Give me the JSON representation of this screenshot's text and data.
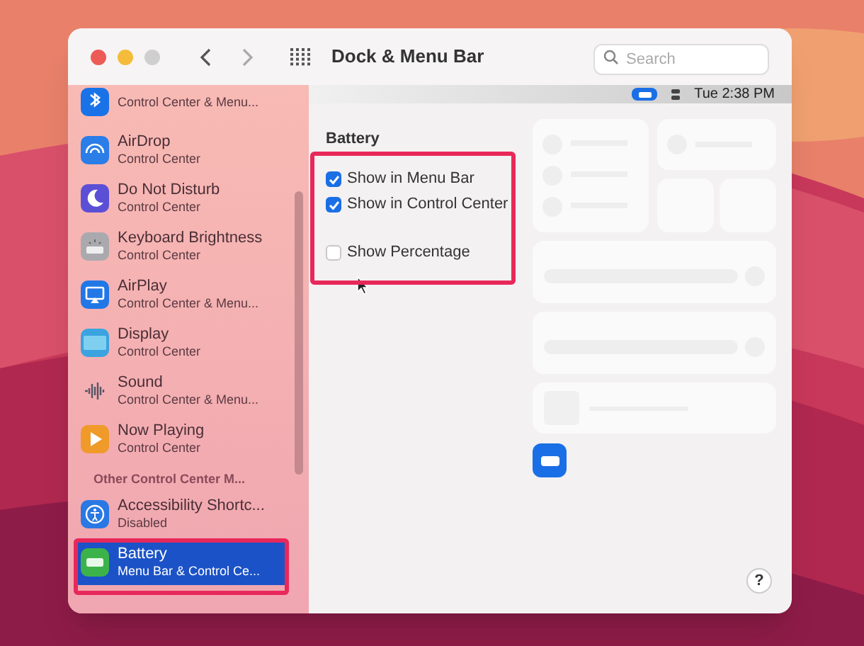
{
  "window": {
    "title": "Dock & Menu Bar",
    "search": {
      "placeholder": "Search"
    }
  },
  "sidebar": {
    "items": [
      {
        "subtitle": "Control Center & Menu...",
        "selected": false
      },
      {
        "title": "AirDrop",
        "subtitle": "Control Center",
        "selected": false
      },
      {
        "title": "Do Not Disturb",
        "subtitle": "Control Center",
        "selected": false
      },
      {
        "title": "Keyboard Brightness",
        "subtitle": "Control Center",
        "selected": false
      },
      {
        "title": "AirPlay",
        "subtitle": "Control Center & Menu...",
        "selected": false
      },
      {
        "title": "Display",
        "subtitle": "Control Center",
        "selected": false
      },
      {
        "title": "Sound",
        "subtitle": "Control Center & Menu...",
        "selected": false
      },
      {
        "title": "Now Playing",
        "subtitle": "Control Center",
        "selected": false
      }
    ],
    "section": "Other Control Center M...",
    "other_items": [
      {
        "title": "Accessibility Shortc...",
        "subtitle": "Disabled",
        "selected": false
      },
      {
        "title": "Battery",
        "subtitle": "Menu Bar & Control Ce...",
        "selected": true
      }
    ]
  },
  "menu_bar_preview": {
    "clock": "Tue 2:38 PM"
  },
  "pane": {
    "heading": "Battery",
    "options": [
      {
        "label": "Show in Menu Bar",
        "checked": true
      },
      {
        "label": "Show in Control Center",
        "checked": true
      },
      {
        "label": "Show Percentage",
        "checked": false
      }
    ]
  },
  "help": "?"
}
